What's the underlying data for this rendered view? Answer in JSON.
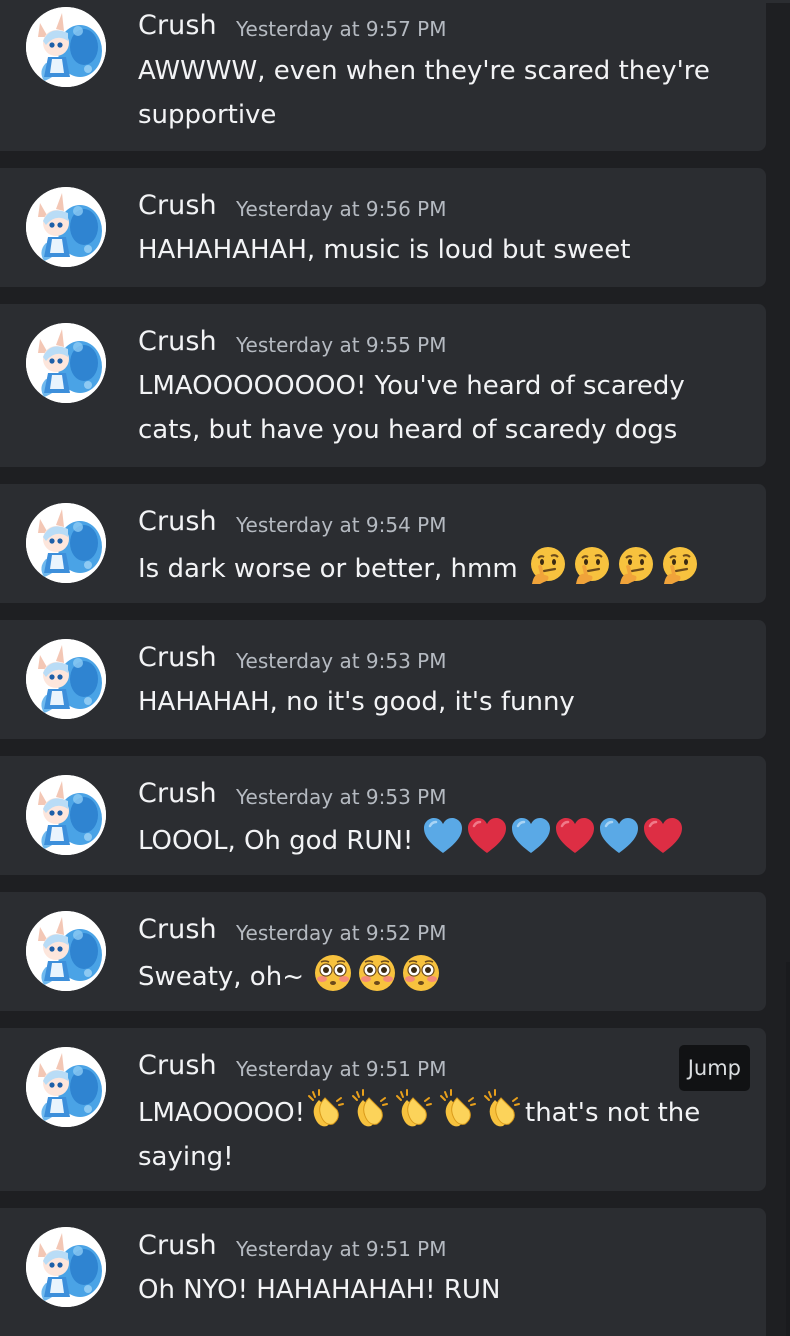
{
  "messages": [
    {
      "author": "Crush",
      "timestamp": "Yesterday at 9:57 PM",
      "text": "AWWWW, even when they're scared they're supportive",
      "emojis": [],
      "suffix": ""
    },
    {
      "author": "Crush",
      "timestamp": "Yesterday at 9:56 PM",
      "text": "HAHAHAHAH, music is loud but sweet",
      "emojis": [],
      "suffix": ""
    },
    {
      "author": "Crush",
      "timestamp": "Yesterday at 9:55 PM",
      "text": "LMAOOOOOOOO! You've heard of scaredy cats, but have you heard of scaredy dogs",
      "emojis": [],
      "suffix": ""
    },
    {
      "author": "Crush",
      "timestamp": "Yesterday at 9:54 PM",
      "text": "Is dark worse or better, hmm",
      "emojis": [
        "thinking-face",
        "thinking-face",
        "thinking-face",
        "thinking-face"
      ],
      "suffix": ""
    },
    {
      "author": "Crush",
      "timestamp": "Yesterday at 9:53 PM",
      "text": "HAHAHAH, no it's good, it's funny",
      "emojis": [],
      "suffix": ""
    },
    {
      "author": "Crush",
      "timestamp": "Yesterday at 9:53 PM",
      "text": "LOOOL, Oh god RUN!",
      "emojis": [
        "blue-heart",
        "red-heart",
        "blue-heart",
        "red-heart",
        "blue-heart",
        "red-heart"
      ],
      "suffix": ""
    },
    {
      "author": "Crush",
      "timestamp": "Yesterday at 9:52 PM",
      "text": "Sweaty, oh~",
      "emojis": [
        "flushed-face",
        "flushed-face",
        "flushed-face"
      ],
      "suffix": ""
    },
    {
      "author": "Crush",
      "timestamp": "Yesterday at 9:51 PM",
      "text": "LMAOOOOO!",
      "emojis": [
        "clapping-hands",
        "clapping-hands",
        "clapping-hands",
        "clapping-hands",
        "clapping-hands"
      ],
      "suffix": "that's not the saying!",
      "jump_label": "Jump"
    },
    {
      "author": "Crush",
      "timestamp": "Yesterday at 9:51 PM",
      "text": "Oh NYO! HAHAHAHAH! RUN",
      "emojis": [],
      "suffix": ""
    }
  ],
  "colors": {
    "background": "#1e1f22",
    "card": "#2b2d31",
    "username": "#f2f3f5",
    "timestamp": "#b5bac1",
    "message_text": "#f2f3f5",
    "jump_tooltip_bg": "#111214"
  }
}
